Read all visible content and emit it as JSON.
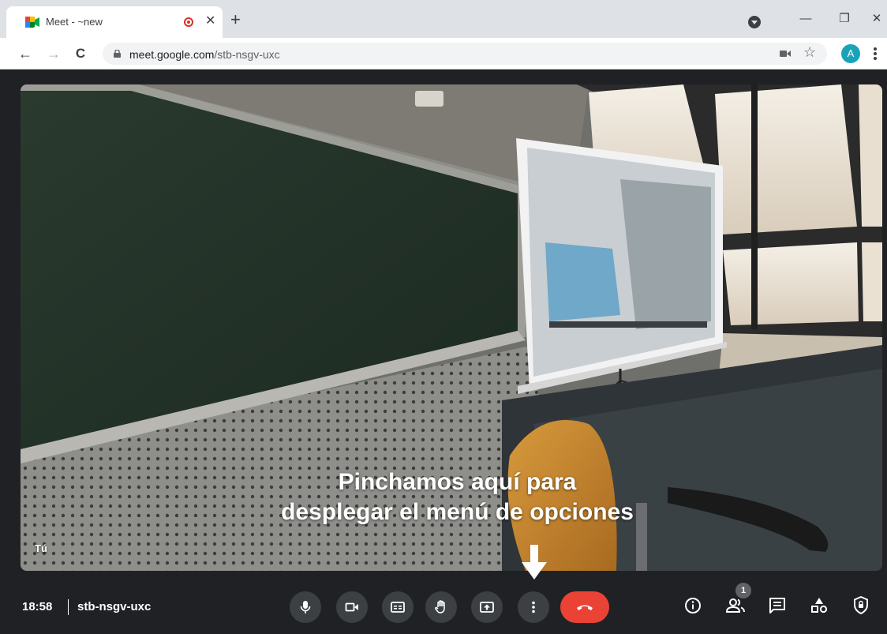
{
  "browser": {
    "tab": {
      "title": "Meet - ~new",
      "close_glyph": "✕",
      "recording_icon": "recording-dot-icon"
    },
    "new_tab_glyph": "+",
    "window": {
      "minimize": "—",
      "restore": "❐",
      "close": "✕"
    },
    "nav": {
      "back": "←",
      "forward": "→",
      "reload": "C"
    },
    "url": {
      "domain": "meet.google.com",
      "path": "/stb-nsgv-uxc"
    },
    "bookmark_glyph": "☆",
    "profile_initial": "A"
  },
  "meet": {
    "overlay_text": [
      "Pinchamos aquí para",
      "desplegar el menú de opciones"
    ],
    "self_label": "Tú",
    "time": "18:58",
    "meeting_code": "stb-nsgv-uxc",
    "participants_count": "1",
    "controls": [
      "microphone-icon",
      "camera-icon",
      "captions-icon",
      "raise-hand-icon",
      "present-screen-icon",
      "more-options-icon",
      "hang-up-icon"
    ],
    "side_controls": [
      "meeting-details-icon",
      "people-icon",
      "chat-icon",
      "activities-icon",
      "host-controls-icon"
    ]
  },
  "colors": {
    "hangup": "#ea4335",
    "control_bg": "#3c4043",
    "page_bg": "#202124",
    "avatar": "#1aa3b8"
  }
}
